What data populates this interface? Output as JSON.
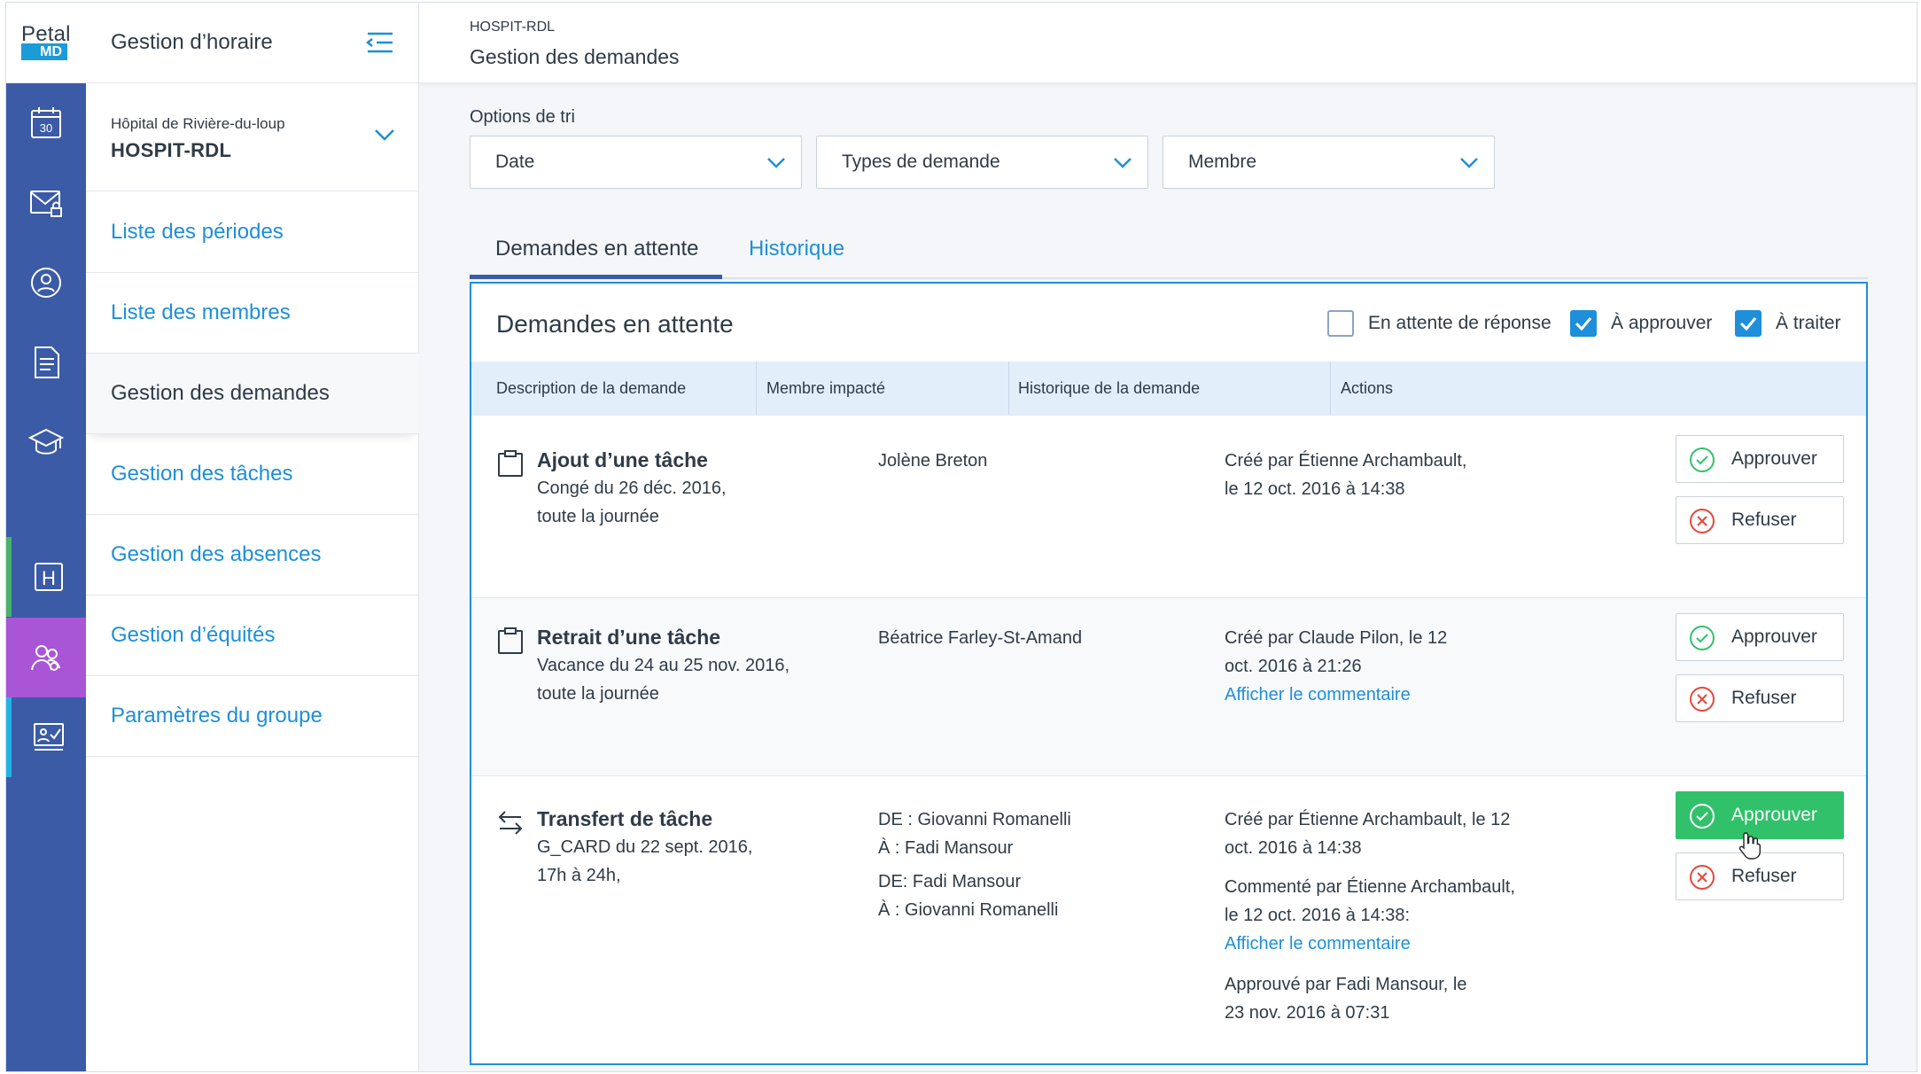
{
  "logo": {
    "petal": "Petal",
    "md": "MD"
  },
  "sidebar": {
    "title": "Gestion d’horaire",
    "hospital_sub": "Hôpital de Rivière-du-loup",
    "hospital_name": "HOSPIT-RDL",
    "items": [
      {
        "label": "Liste des périodes"
      },
      {
        "label": "Liste des membres"
      },
      {
        "label": "Gestion des demandes"
      },
      {
        "label": "Gestion des tâches"
      },
      {
        "label": "Gestion des absences"
      },
      {
        "label": "Gestion d’équités"
      },
      {
        "label": "Paramètres du groupe"
      }
    ]
  },
  "rail": {
    "icons": [
      "calendar-icon",
      "mail-lock-icon",
      "user-circle-icon",
      "document-icon",
      "graduation-cap-icon",
      "hospital-icon",
      "group-icon",
      "presentation-check-icon"
    ],
    "calendar_day": "30",
    "hospital_letter": "H",
    "colors": {
      "rail": "#3c5ba6",
      "active": "#a855d6",
      "green_marker": "#46b36a",
      "cyan_marker": "#22b3e6"
    }
  },
  "header": {
    "breadcrumb": "HOSPIT-RDL",
    "title": "Gestion des demandes"
  },
  "sort": {
    "label": "Options de tri",
    "selects": [
      {
        "value": "Date"
      },
      {
        "value": "Types de demande"
      },
      {
        "value": "Membre"
      }
    ]
  },
  "tabs": [
    {
      "label": "Demandes en attente"
    },
    {
      "label": "Historique"
    }
  ],
  "panel": {
    "title": "Demandes en attente",
    "filters": [
      {
        "label": "En attente de réponse",
        "checked": false
      },
      {
        "label": "À approuver",
        "checked": true
      },
      {
        "label": "À traiter",
        "checked": true
      }
    ],
    "columns": [
      "Description de la demande",
      "Membre impacté",
      "Historique de la demande",
      "Actions"
    ],
    "rows": [
      {
        "icon": "clipboard-icon",
        "title": "Ajout d’une tâche",
        "desc1": "Congé du 26 déc. 2016,",
        "desc2": "toute la journée",
        "member": "Jolène Breton",
        "history1": "Créé par Étienne Archambault,",
        "history2": "le 12 oct. 2016 à 14:38"
      },
      {
        "icon": "clipboard-icon",
        "title": "Retrait d’une tâche",
        "desc1": "Vacance du 24 au 25 nov. 2016,",
        "desc2": "toute la journée",
        "member": "Béatrice Farley-St-Amand",
        "history1": "Créé par Claude Pilon, le 12",
        "history2": "oct. 2016 à 21:26",
        "comment_link": "Afficher le commentaire"
      },
      {
        "icon": "transfer-arrows-icon",
        "title": "Transfert de tâche",
        "desc1": "G_CARD du 22 sept. 2016,",
        "desc2": "17h à 24h,",
        "member_lines": [
          "DE  : Giovanni Romanelli",
          "À  : Fadi Mansour",
          "DE:  Fadi Mansour",
          "À : Giovanni Romanelli"
        ],
        "history1": "Créé par Étienne Archambault, le 12",
        "history2": "oct. 2016 à 14:38",
        "comment1": "Commenté par Étienne Archambault,",
        "comment2": "le 12 oct. 2016 à 14:38:",
        "comment_link": "Afficher le commentaire",
        "approved1": "Approuvé par Fadi Mansour, le",
        "approved2": "23 nov. 2016 à 07:31"
      }
    ],
    "actions": {
      "approve": "Approuver",
      "refuse": "Refuser"
    }
  },
  "colors": {
    "link": "#1e8fd8",
    "approve_green": "#31c16a",
    "refuse_red": "#e5473b",
    "panel_border": "#1e8fd8"
  }
}
